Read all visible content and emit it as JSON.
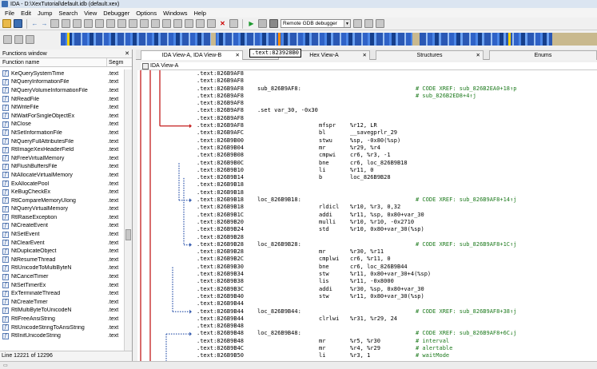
{
  "window": {
    "title": "IDA - D:\\XexTutorial\\default.idb (default.xex)"
  },
  "menu": [
    "File",
    "Edit",
    "Jump",
    "Search",
    "View",
    "Debugger",
    "Options",
    "Windows",
    "Help"
  ],
  "toolbar": {
    "debugger_select": "Remote GDB debugger"
  },
  "functions_window": {
    "title": "Functions window",
    "col_name": "Function name",
    "col_segment": "Segm",
    "status": "Line 12221 of 12296",
    "rows": [
      {
        "name": "KeQuerySystemTime",
        "seg": ".text"
      },
      {
        "name": "NtQueryInformationFile",
        "seg": ".text"
      },
      {
        "name": "NtQueryVolumeInformationFile",
        "seg": ".text"
      },
      {
        "name": "NtReadFile",
        "seg": ".text"
      },
      {
        "name": "NtWriteFile",
        "seg": ".text"
      },
      {
        "name": "NtWaitForSingleObjectEx",
        "seg": ".text"
      },
      {
        "name": "NtClose",
        "seg": ".text"
      },
      {
        "name": "NtSetInformationFile",
        "seg": ".text"
      },
      {
        "name": "NtQueryFullAttributesFile",
        "seg": ".text"
      },
      {
        "name": "RtlImageXexHeaderField",
        "seg": ".text"
      },
      {
        "name": "NtFreeVirtualMemory",
        "seg": ".text"
      },
      {
        "name": "NtFlushBuffersFile",
        "seg": ".text"
      },
      {
        "name": "NtAllocateVirtualMemory",
        "seg": ".text"
      },
      {
        "name": "ExAllocatePool",
        "seg": ".text"
      },
      {
        "name": "KeBugCheckEx",
        "seg": ".text"
      },
      {
        "name": "RtlCompareMemoryUlong",
        "seg": ".text"
      },
      {
        "name": "NtQueryVirtualMemory",
        "seg": ".text"
      },
      {
        "name": "RtlRaiseException",
        "seg": ".text"
      },
      {
        "name": "NtCreateEvent",
        "seg": ".text"
      },
      {
        "name": "NtSetEvent",
        "seg": ".text"
      },
      {
        "name": "NtClearEvent",
        "seg": ".text"
      },
      {
        "name": "NtDuplicateObject",
        "seg": ".text"
      },
      {
        "name": "NtResumeThread",
        "seg": ".text"
      },
      {
        "name": "RtlUnicodeToMultiByteN",
        "seg": ".text"
      },
      {
        "name": "NtCancelTimer",
        "seg": ".text"
      },
      {
        "name": "NtSetTimerEx",
        "seg": ".text"
      },
      {
        "name": "ExTerminateThread",
        "seg": ".text"
      },
      {
        "name": "NtCreateTimer",
        "seg": ".text"
      },
      {
        "name": "RtlMultiByteToUnicodeN",
        "seg": ".text"
      },
      {
        "name": "RtlFreeAnsiString",
        "seg": ".text"
      },
      {
        "name": "RtlUnicodeStringToAnsiString",
        "seg": ".text"
      },
      {
        "name": "RtlInitUnicodeString",
        "seg": ".text"
      }
    ]
  },
  "tabs": [
    {
      "label": "IDA View-A, IDA View-B",
      "active": true
    },
    {
      "label": "Hex View-A",
      "active": false
    },
    {
      "label": "Structures",
      "active": false
    },
    {
      "label": "Enums",
      "active": false
    }
  ],
  "tooltip": ".text:823928B0",
  "view_title": "IDA View-A",
  "code": [
    {
      "addr": ".text:826B9AF8"
    },
    {
      "addr": ".text:826B9AF8"
    },
    {
      "addr": ".text:826B9AF8",
      "lbl": "sub_826B9AF8:",
      "xref": "# CODE XREF: sub_826B2EA0+18↑p"
    },
    {
      "addr": ".text:826B9AF8",
      "xref": "# sub_826B2ED8+4↑j"
    },
    {
      "addr": ".text:826B9AF8"
    },
    {
      "addr": ".text:826B9AF8",
      "lbl": ".set var_30, -0x30"
    },
    {
      "addr": ".text:826B9AF8"
    },
    {
      "addr": ".text:826B9AF8",
      "mn": "mfspr",
      "op": "%r12, LR"
    },
    {
      "addr": ".text:826B9AFC",
      "mn": "bl",
      "op": "__savegprlr_29"
    },
    {
      "addr": ".text:826B9B00",
      "mn": "stwu",
      "op": "%sp, -0x80(%sp)"
    },
    {
      "addr": ".text:826B9B04",
      "mn": "mr",
      "op": "%r29, %r4"
    },
    {
      "addr": ".text:826B9B08",
      "mn": "cmpwi",
      "op": "cr6, %r3, -1"
    },
    {
      "addr": ".text:826B9B0C",
      "mn": "bne",
      "op": "cr6, loc_826B9B18"
    },
    {
      "addr": ".text:826B9B10",
      "mn": "li",
      "op": "%r11, 0"
    },
    {
      "addr": ".text:826B9B14",
      "mn": "b",
      "op": "loc_826B9B28"
    },
    {
      "addr": ".text:826B9B18",
      "sep": true
    },
    {
      "addr": ".text:826B9B18"
    },
    {
      "addr": ".text:826B9B18",
      "lbl": "loc_826B9B18:",
      "xref": "# CODE XREF: sub_826B9AF8+14↑j"
    },
    {
      "addr": ".text:826B9B18",
      "mn": "rldicl",
      "op": "%r10, %r3, 0,32"
    },
    {
      "addr": ".text:826B9B1C",
      "mn": "addi",
      "op": "%r11, %sp, 0x80+var_30"
    },
    {
      "addr": ".text:826B9B20",
      "mn": "mulli",
      "op": "%r10, %r10, -0x2710"
    },
    {
      "addr": ".text:826B9B24",
      "mn": "std",
      "op": "%r10, 0x80+var_30(%sp)"
    },
    {
      "addr": ".text:826B9B28"
    },
    {
      "addr": ".text:826B9B28",
      "lbl": "loc_826B9B28:",
      "xref": "# CODE XREF: sub_826B9AF8+1C↑j"
    },
    {
      "addr": ".text:826B9B28",
      "mn": "mr",
      "op": "%r30, %r11"
    },
    {
      "addr": ".text:826B9B2C",
      "mn": "cmplwi",
      "op": "cr6, %r11, 0"
    },
    {
      "addr": ".text:826B9B30",
      "mn": "bne",
      "op": "cr6, loc_826B9B44"
    },
    {
      "addr": ".text:826B9B34",
      "mn": "stw",
      "op": "%r11, 0x80+var_30+4(%sp)"
    },
    {
      "addr": ".text:826B9B38",
      "mn": "lis",
      "op": "%r11, -0x8000"
    },
    {
      "addr": ".text:826B9B3C",
      "mn": "addi",
      "op": "%r30, %sp, 0x80+var_30"
    },
    {
      "addr": ".text:826B9B40",
      "mn": "stw",
      "op": "%r11, 0x80+var_30(%sp)"
    },
    {
      "addr": ".text:826B9B44"
    },
    {
      "addr": ".text:826B9B44",
      "lbl": "loc_826B9B44:",
      "xref": "# CODE XREF: sub_826B9AF8+38↑j"
    },
    {
      "addr": ".text:826B9B44",
      "mn": "clrlwi",
      "op": "%r31, %r29, 24"
    },
    {
      "addr": ".text:826B9B48"
    },
    {
      "addr": ".text:826B9B48",
      "lbl": "loc_826B9B48:",
      "xref": "# CODE XREF: sub_826B9AF8+6C↓j"
    },
    {
      "addr": ".text:826B9B48",
      "mn": "mr",
      "op": "%r5, %r30",
      "cm": "# interval"
    },
    {
      "addr": ".text:826B9B4C",
      "mn": "mr",
      "op": "%r4, %r29",
      "cm": "# alertable"
    },
    {
      "addr": ".text:826B9B50",
      "mn": "li",
      "op": "%r3, 1",
      "cm": "# waitMode"
    }
  ]
}
